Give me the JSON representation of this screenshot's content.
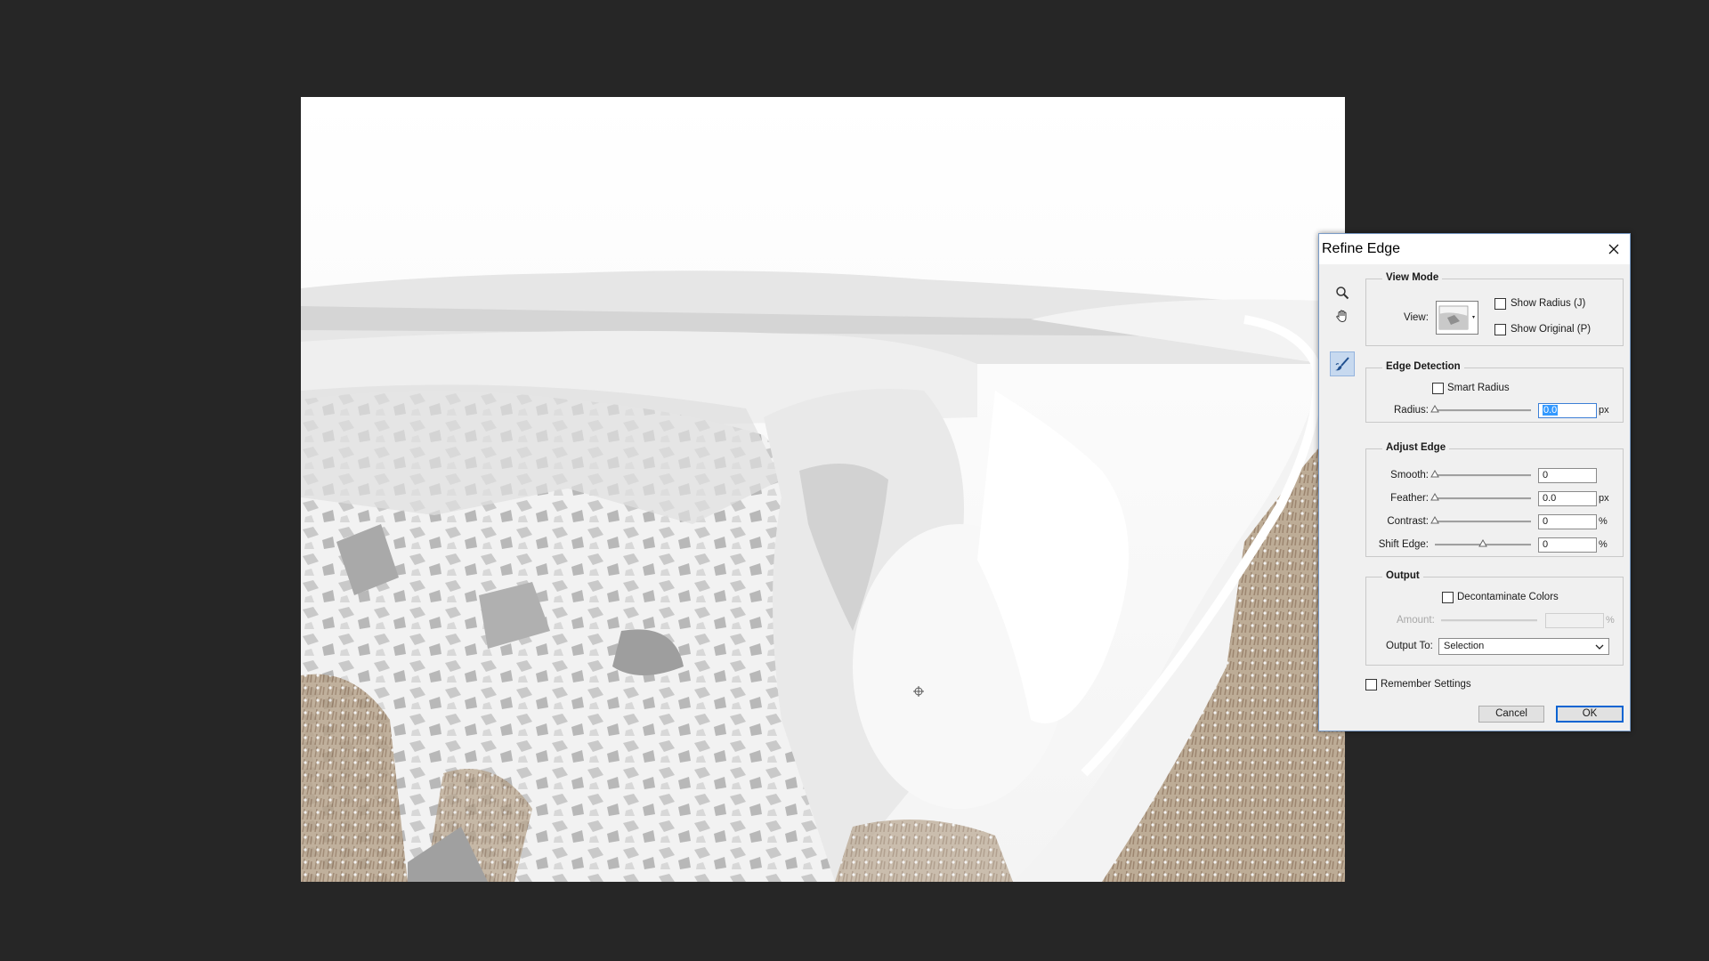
{
  "dialog": {
    "title": "Refine Edge",
    "view_mode": {
      "heading": "View Mode",
      "view_label": "View:",
      "show_radius": {
        "label": "Show Radius (J)",
        "checked": false
      },
      "show_original": {
        "label": "Show Original (P)",
        "checked": false
      }
    },
    "edge_detection": {
      "heading": "Edge Detection",
      "smart_radius": {
        "label": "Smart Radius",
        "checked": false
      },
      "radius": {
        "label": "Radius:",
        "value": "0.0",
        "unit": "px",
        "level": 0
      }
    },
    "adjust_edge": {
      "heading": "Adjust Edge",
      "smooth": {
        "label": "Smooth:",
        "value": "0",
        "unit": "",
        "level": 0
      },
      "feather": {
        "label": "Feather:",
        "value": "0.0",
        "unit": "px",
        "level": 0
      },
      "contrast": {
        "label": "Contrast:",
        "value": "0",
        "unit": "%",
        "level": 0
      },
      "shift_edge": {
        "label": "Shift Edge:",
        "value": "0",
        "unit": "%",
        "level": 0.5
      }
    },
    "output": {
      "heading": "Output",
      "decontaminate": {
        "label": "Decontaminate Colors",
        "checked": false
      },
      "amount": {
        "label": "Amount:",
        "value": "",
        "unit": "%"
      },
      "output_to": {
        "label": "Output To:",
        "value": "Selection"
      }
    },
    "remember_settings": {
      "label": "Remember Settings",
      "checked": false
    },
    "buttons": {
      "cancel": "Cancel",
      "ok": "OK"
    }
  },
  "colors": {
    "background": "#262626",
    "accent": "#0a64d2",
    "selection": "#3399ff",
    "terrain_brown": "#9c8468"
  },
  "icons": [
    "zoom-icon",
    "hand-icon",
    "refine-radius-brush-icon",
    "close-icon",
    "chevron-down-icon"
  ]
}
